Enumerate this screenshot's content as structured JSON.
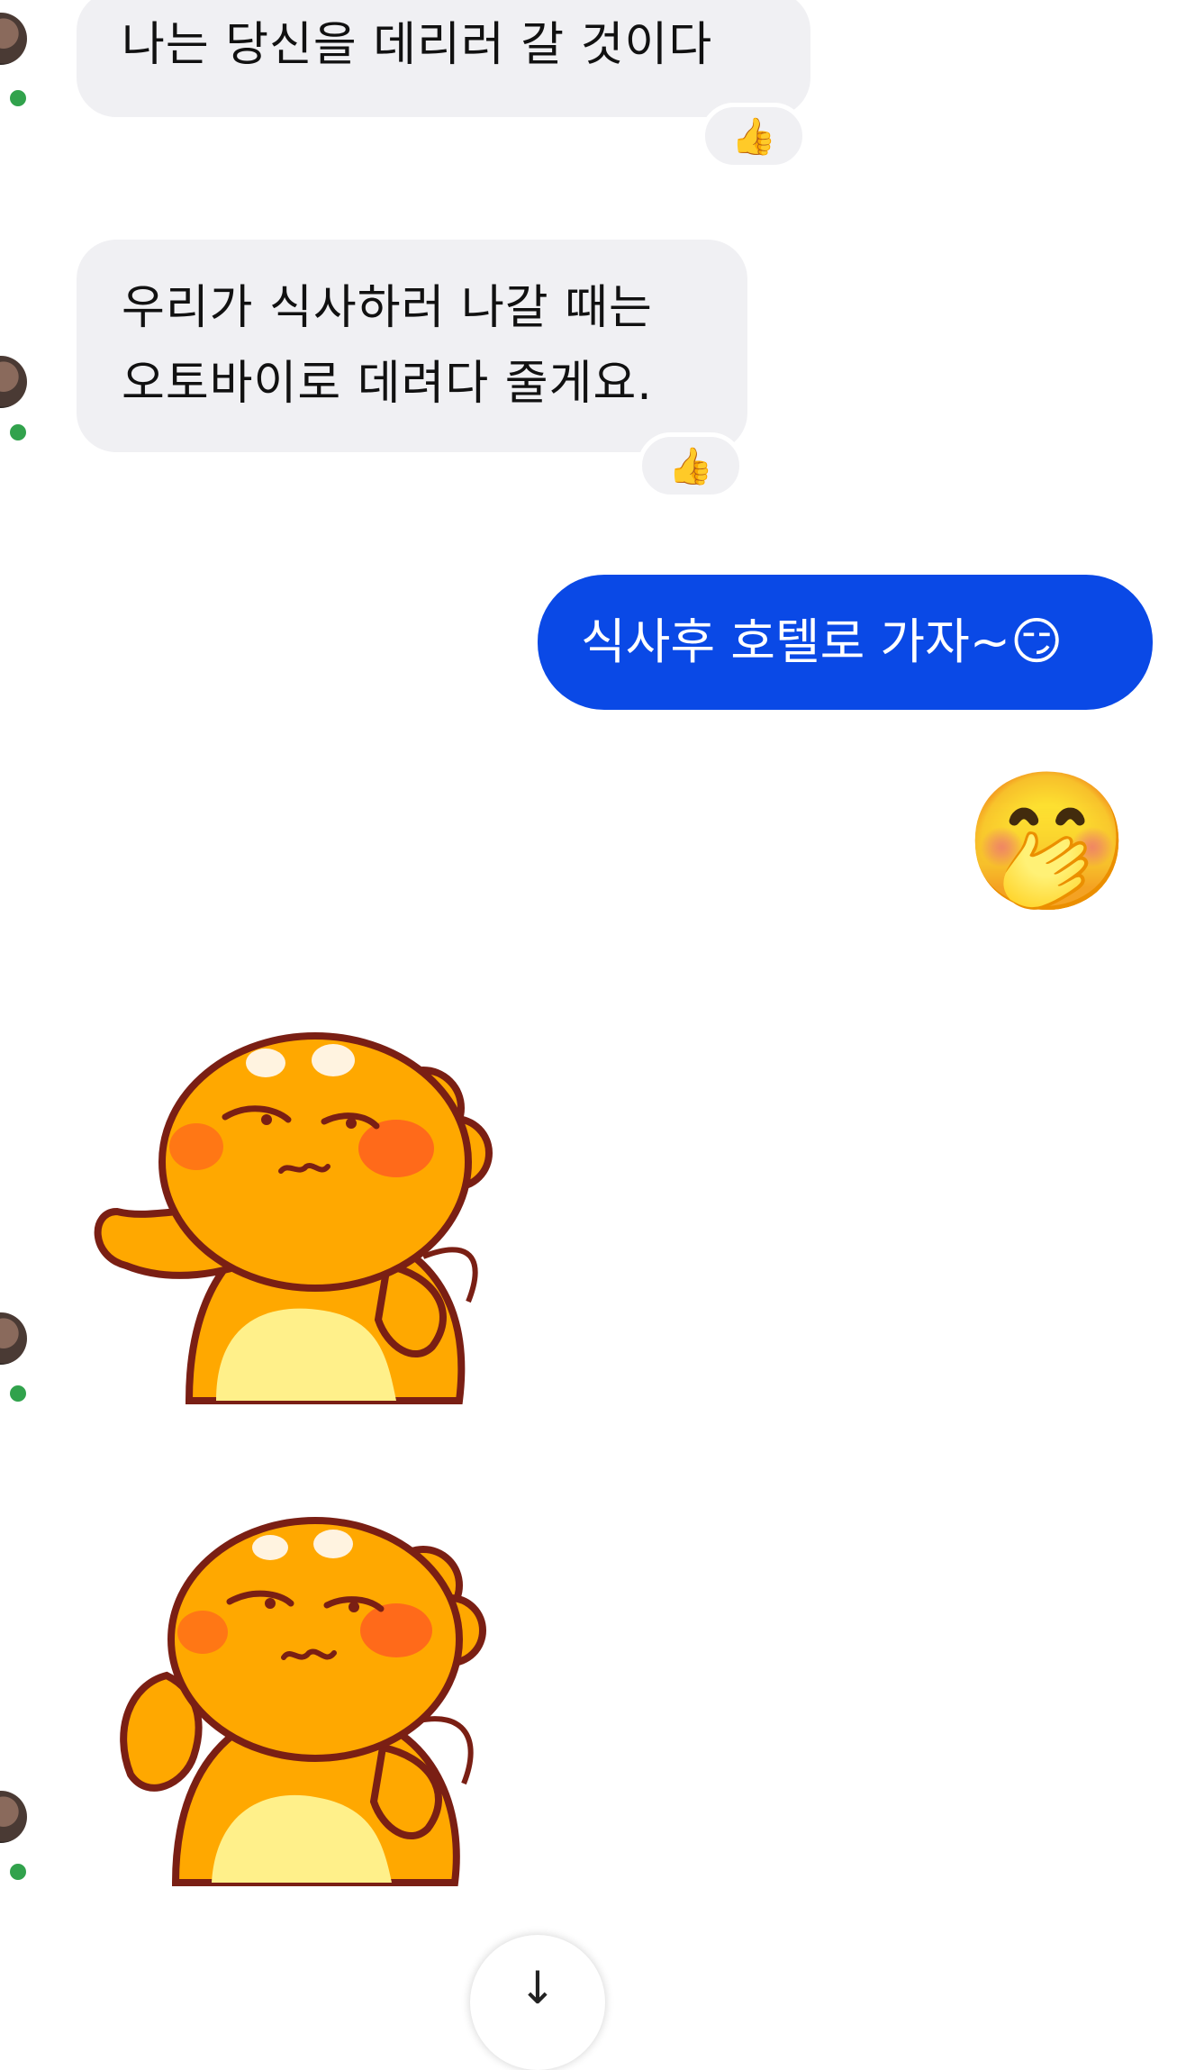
{
  "messages": [
    {
      "id": "m1",
      "direction": "incoming",
      "lines": [
        "나는 당신을 데리러 갈 것이다"
      ],
      "reaction": "👍"
    },
    {
      "id": "m2",
      "direction": "incoming",
      "lines": [
        "우리가 식사하러 나갈 때는",
        "오토바이로 데려다 줄게요."
      ],
      "reaction": "👍"
    },
    {
      "id": "m3",
      "direction": "outgoing",
      "text": "식사후 호텔로 가자~",
      "emoji": "😏"
    },
    {
      "id": "m4",
      "direction": "outgoing",
      "type": "emoji",
      "emoji": "🤭"
    },
    {
      "id": "m5",
      "direction": "incoming",
      "type": "sticker",
      "sticker": "orange-bear-sticker-waving"
    },
    {
      "id": "m6",
      "direction": "incoming",
      "type": "sticker",
      "sticker": "orange-bear-sticker-shy"
    }
  ],
  "colors": {
    "incoming_bubble": "#f0f0f3",
    "outgoing_bubble": "#0a49e6",
    "online_dot": "#31a24c",
    "sticker_body": "#ffa800",
    "sticker_outline": "#7a1f14"
  },
  "scroll_button": {
    "icon": "arrow-down-icon"
  }
}
